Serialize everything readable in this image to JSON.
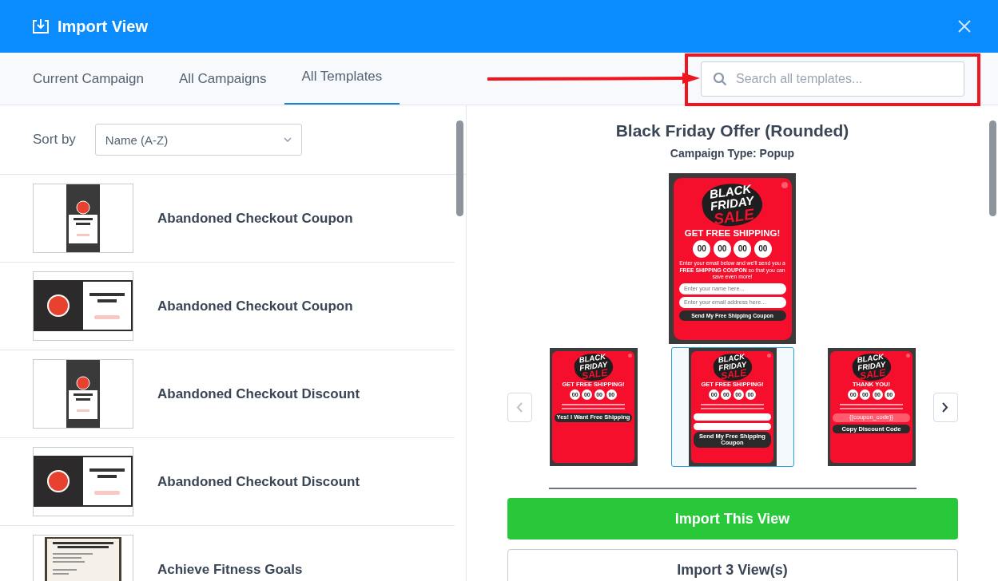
{
  "window": {
    "title": "Import View"
  },
  "tabs": [
    {
      "label": "Current Campaign",
      "selected": false
    },
    {
      "label": "All Campaigns",
      "selected": false
    },
    {
      "label": "All Templates",
      "selected": true
    }
  ],
  "search": {
    "placeholder": "Search all templates..."
  },
  "sort": {
    "label": "Sort by",
    "value": "Name (A-Z)"
  },
  "templates": [
    {
      "name": "Abandoned Checkout Coupon",
      "kind": "portrait"
    },
    {
      "name": "Abandoned Checkout Coupon",
      "kind": "landscape"
    },
    {
      "name": "Abandoned Checkout Discount",
      "kind": "portrait"
    },
    {
      "name": "Abandoned Checkout Discount",
      "kind": "landscape"
    },
    {
      "name": "Achieve Fitness Goals",
      "kind": "document"
    }
  ],
  "preview": {
    "title": "Black Friday Offer (Rounded)",
    "campaign_type": "Campaign Type: Popup",
    "main": {
      "kind": "optin",
      "logo": [
        "BLACK",
        "FRIDAY",
        "SALE"
      ],
      "heading": "GET FREE SHIPPING!",
      "countdown": [
        "00",
        "00",
        "00",
        "00"
      ],
      "body": "Enter your email below and we'll send you a **FREE SHIPPING COUPON** so that you can save even more!",
      "fields": [
        "Enter your name here...",
        "Enter your email address here..."
      ],
      "button": "Send My Free Shipping Coupon"
    },
    "views": [
      {
        "kind": "yesno",
        "selected": false,
        "logo": [
          "BLACK",
          "FRIDAY",
          "SALE"
        ],
        "heading": "GET FREE SHIPPING!",
        "countdown": [
          "00",
          "00",
          "00",
          "00"
        ],
        "button": "Yes! I Want Free Shipping"
      },
      {
        "kind": "optin",
        "selected": true,
        "logo": [
          "BLACK",
          "FRIDAY",
          "SALE"
        ],
        "heading": "GET FREE SHIPPING!",
        "countdown": [
          "00",
          "00",
          "00",
          "00"
        ],
        "button": "Send My Free Shipping Coupon"
      },
      {
        "kind": "success",
        "selected": false,
        "logo": [
          "BLACK",
          "FRIDAY",
          "SALE"
        ],
        "heading": "THANK YOU!",
        "countdown": [
          "00",
          "00",
          "00",
          "00"
        ],
        "coupon": "{{coupon_code}}",
        "button": "Copy Discount Code"
      }
    ]
  },
  "actions": {
    "primary": "Import This View",
    "secondary": "Import 3 View(s)"
  }
}
